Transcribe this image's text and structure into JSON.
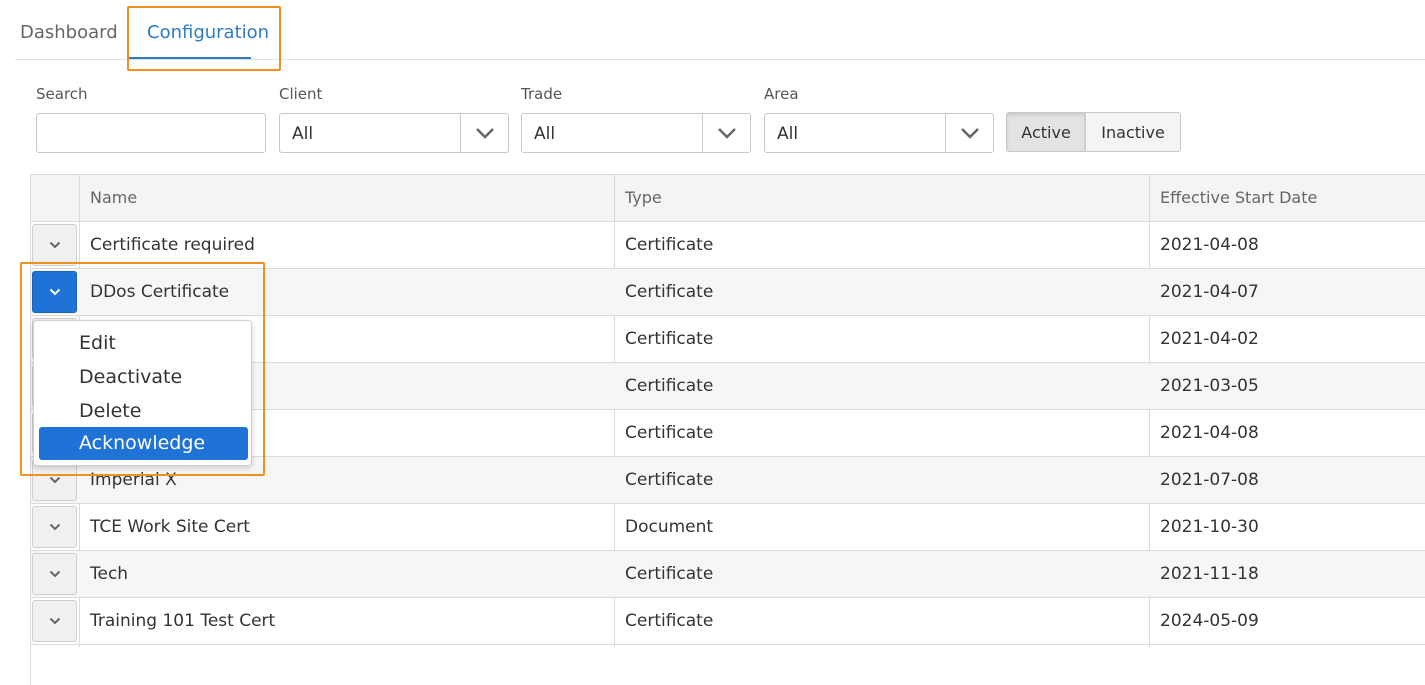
{
  "tabs": [
    {
      "label": "Dashboard"
    },
    {
      "label": "Configuration"
    }
  ],
  "filters": {
    "search": {
      "label": "Search",
      "value": "",
      "placeholder": ""
    },
    "client": {
      "label": "Client",
      "value": "All"
    },
    "trade": {
      "label": "Trade",
      "value": "All"
    },
    "area": {
      "label": "Area",
      "value": "All"
    },
    "status_toggle": {
      "active_label": "Active",
      "inactive_label": "Inactive",
      "selected": "Active"
    }
  },
  "table": {
    "columns": [
      "Name",
      "Type",
      "Effective Start Date"
    ],
    "rows": [
      {
        "name": "Certificate required",
        "type": "Certificate",
        "date": "2021-04-08"
      },
      {
        "name": "DDos Certificate",
        "type": "Certificate",
        "date": "2021-04-07"
      },
      {
        "name": "",
        "type": "Certificate",
        "date": "2021-04-02"
      },
      {
        "name": "",
        "type": "Certificate",
        "date": "2021-03-05"
      },
      {
        "name": "",
        "type": "Certificate",
        "date": "2021-04-08"
      },
      {
        "name": "Imperial X",
        "type": "Certificate",
        "date": "2021-07-08"
      },
      {
        "name": "TCE Work Site Cert",
        "type": "Document",
        "date": "2021-10-30"
      },
      {
        "name": "Tech",
        "type": "Certificate",
        "date": "2021-11-18"
      },
      {
        "name": "Training 101 Test Cert",
        "type": "Certificate",
        "date": "2024-05-09"
      }
    ]
  },
  "row_menu": {
    "items": [
      "Edit",
      "Deactivate",
      "Delete",
      "Acknowledge"
    ],
    "highlighted": "Acknowledge"
  },
  "colors": {
    "accent": "#2e7bc4",
    "selected": "#1f73d6",
    "highlight_box": "#f0901e"
  }
}
